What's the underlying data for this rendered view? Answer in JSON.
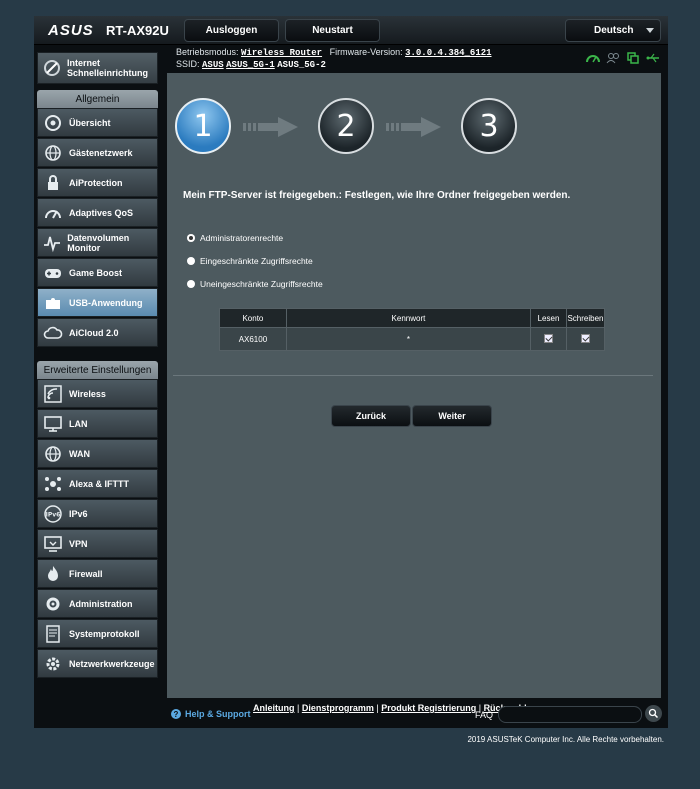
{
  "header": {
    "logo": "ASUS",
    "model": "RT-AX92U",
    "logout_label": "Ausloggen",
    "reboot_label": "Neustart",
    "language": "Deutsch"
  },
  "status": {
    "mode_label": "Betriebsmodus:",
    "mode_value": "Wireless Router",
    "firmware_label": "Firmware-Version:",
    "firmware_value": "3.0.0.4.384_6121",
    "ssid_label": "SSID:",
    "ssids": [
      "ASUS",
      "ASUS_5G-1",
      "ASUS_5G-2"
    ]
  },
  "sidebar": {
    "quick_setup": "Internet Schnelleinrichtung",
    "general_header": "Allgemein",
    "general_items": [
      "Übersicht",
      "Gästenetzwerk",
      "AiProtection",
      "Adaptives QoS",
      "Datenvolumen Monitor",
      "Game Boost",
      "USB-Anwendung",
      "AiCloud 2.0"
    ],
    "advanced_header": "Erweiterte Einstellungen",
    "advanced_items": [
      "Wireless",
      "LAN",
      "WAN",
      "Alexa & IFTTT",
      "IPv6",
      "VPN",
      "Firewall",
      "Administration",
      "Systemprotokoll",
      "Netzwerkwerkzeuge"
    ]
  },
  "wizard": {
    "steps": [
      "1",
      "2",
      "3"
    ],
    "title": "Mein FTP-Server ist freigegeben.: Festlegen, wie Ihre Ordner freigegeben werden.",
    "options": [
      "Administratorenrechte",
      "Eingeschränkte Zugriffsrechte",
      "Uneingeschränkte Zugriffsrechte"
    ],
    "table": {
      "headers": [
        "Konto",
        "Kennwort",
        "Lesen",
        "Schreiben"
      ],
      "rows": [
        {
          "account": "AX6100",
          "password": "*"
        }
      ]
    },
    "back_label": "Zurück",
    "next_label": "Weiter"
  },
  "footer": {
    "help": "Help & Support",
    "link1": "Anleitung",
    "link2": "Dienstprogramm",
    "link3": "Produkt Registrierung",
    "link4": "Rückmeldung",
    "faq": "FAQ",
    "copyright": "2019 ASUSTeK Computer Inc. Alle Rechte vorbehalten."
  }
}
